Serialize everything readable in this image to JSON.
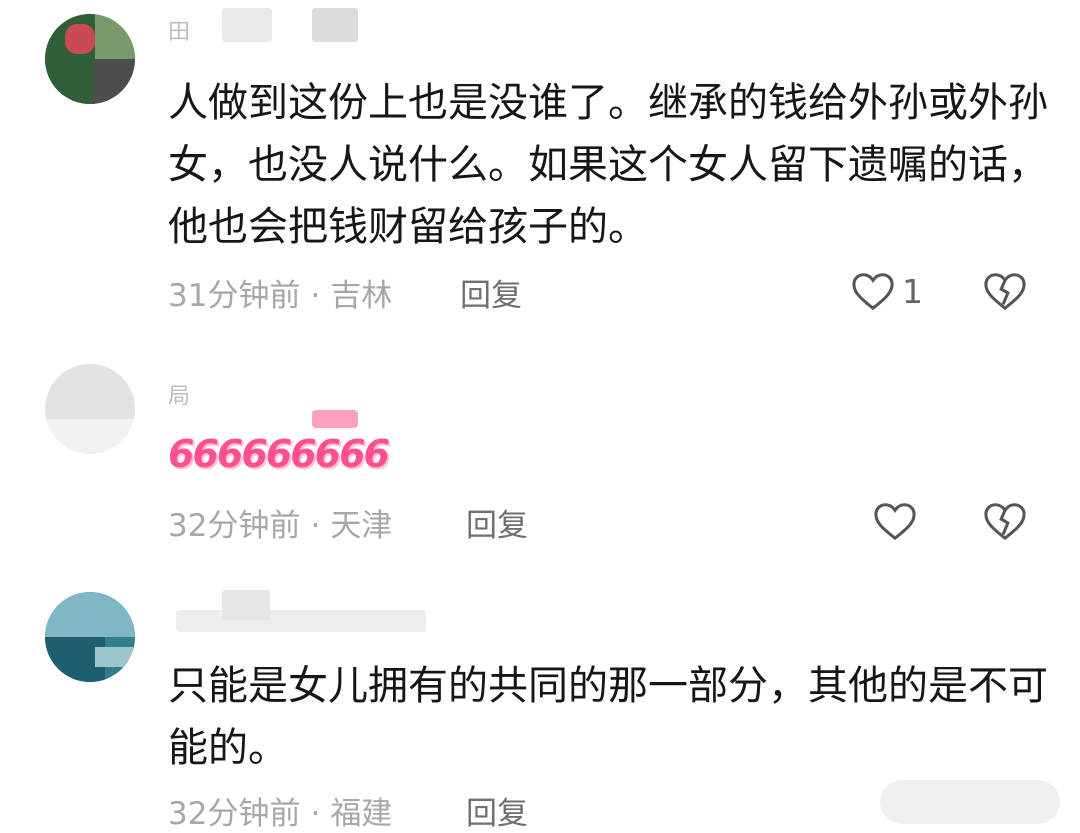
{
  "comments": [
    {
      "username_fragment": "田",
      "text": "人做到这份上也是没谁了。继承的钱给外孙或外孙女，也没人说什么。如果这个女人留下遗嘱的话，他也会把钱财留给孩子的。",
      "time": "31分钟前",
      "location": "吉林",
      "reply_label": "回复",
      "like_count": "1"
    },
    {
      "username_fragment": "局",
      "text": "",
      "emoji_text": "666666666",
      "time": "32分钟前",
      "location": "天津",
      "reply_label": "回复",
      "like_count": ""
    },
    {
      "username_fragment": "",
      "text": "只能是女儿拥有的共同的那一部分，其他的是不可能的。",
      "time": "32分钟前",
      "location": "福建",
      "reply_label": "回复",
      "like_count": ""
    }
  ],
  "separator": "·",
  "icons": {
    "like": "heart-outline-icon",
    "dislike": "broken-heart-icon"
  },
  "colors": {
    "text": "#161616",
    "meta": "#a7a7a7",
    "reply": "#6f6f6f",
    "icon": "#555555"
  }
}
